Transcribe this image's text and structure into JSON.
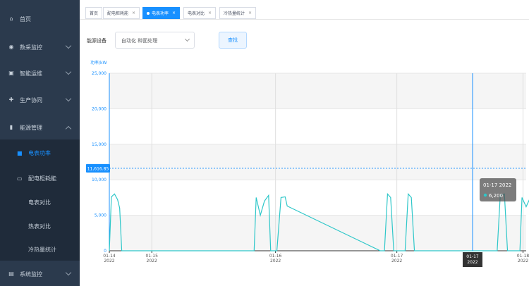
{
  "sidebar": {
    "items": [
      {
        "label": "首页",
        "icon": "home-icon",
        "glyph": "⌂",
        "chevron": false
      },
      {
        "label": "数采监控",
        "icon": "monitor-icon",
        "glyph": "◉",
        "chevron": true
      },
      {
        "label": "智能运维",
        "icon": "wrench-icon",
        "glyph": "▣",
        "chevron": true
      },
      {
        "label": "生产协同",
        "icon": "sync-icon",
        "glyph": "✚",
        "chevron": true
      },
      {
        "label": "能源管理",
        "icon": "bar-chart-icon",
        "glyph": "▮",
        "chevron": true,
        "expanded": true
      },
      {
        "label": "系统监控",
        "icon": "system-icon",
        "glyph": "▤",
        "chevron": true
      }
    ],
    "sub_items": [
      {
        "label": "电表功率",
        "active": true,
        "glyph": "■"
      },
      {
        "label": "配电柜耗能",
        "active": false,
        "glyph": "▭"
      },
      {
        "label": "电表对比",
        "active": false
      },
      {
        "label": "热表对比",
        "active": false
      },
      {
        "label": "冷热量统计",
        "active": false
      }
    ]
  },
  "tabs": [
    {
      "label": "首页",
      "closable": false,
      "active": false
    },
    {
      "label": "配电柜耗能",
      "closable": true,
      "active": false
    },
    {
      "label": "电表功率",
      "closable": true,
      "active": true
    },
    {
      "label": "电表对比",
      "closable": true,
      "active": false
    },
    {
      "label": "冷热量统计",
      "closable": true,
      "active": false
    }
  ],
  "filter": {
    "label": "能源设备",
    "selected": "自动化 种面处理",
    "query_button": "查找"
  },
  "colors": {
    "sidebar_bg": "#2b3a4d",
    "accent": "#1890ff",
    "series": "#2ec7c9"
  },
  "chart_data": {
    "type": "line",
    "ylabel": "功率/kW",
    "ylim": [
      0,
      25000
    ],
    "yticks": [
      "25,000",
      "20,000",
      "15,000",
      "10,000",
      "5,000",
      "0"
    ],
    "xticks": [
      {
        "date": "01-14",
        "year": "2022"
      },
      {
        "date": "01-15",
        "year": "2022"
      },
      {
        "date": "01-16",
        "year": "2022"
      },
      {
        "date": "01-17",
        "year": "2022"
      },
      {
        "date": "01-18",
        "year": "2022"
      }
    ],
    "cursor_label": {
      "date": "01-17",
      "year": "2022"
    },
    "reference_line": {
      "value": 11616.85,
      "label": "11,616.85"
    },
    "tooltip": {
      "title": "01-17 2022",
      "value": "6,200"
    },
    "series": [
      {
        "points": [
          [
            0.0,
            0
          ],
          [
            0.02,
            7600
          ],
          [
            0.05,
            8000
          ],
          [
            0.08,
            7200
          ],
          [
            0.1,
            6000
          ],
          [
            0.12,
            0
          ],
          [
            1.4,
            0
          ],
          [
            1.42,
            7500
          ],
          [
            1.46,
            5000
          ],
          [
            1.5,
            7000
          ],
          [
            1.54,
            7800
          ],
          [
            1.56,
            0
          ],
          [
            1.62,
            0
          ],
          [
            1.66,
            7500
          ],
          [
            1.7,
            7600
          ],
          [
            1.72,
            6300
          ],
          [
            2.62,
            0
          ],
          [
            2.66,
            0
          ],
          [
            2.69,
            8000
          ],
          [
            2.72,
            7500
          ],
          [
            2.75,
            0
          ],
          [
            2.86,
            0
          ],
          [
            2.89,
            8000
          ],
          [
            2.92,
            7500
          ],
          [
            2.95,
            0
          ],
          [
            3.75,
            0
          ],
          [
            3.78,
            7800
          ],
          [
            3.82,
            8000
          ],
          [
            3.85,
            0
          ],
          [
            3.97,
            0
          ],
          [
            3.99,
            7500
          ],
          [
            4.03,
            6200
          ],
          [
            4.08,
            7800
          ],
          [
            4.1,
            0
          ],
          [
            4.95,
            0
          ]
        ]
      }
    ]
  }
}
